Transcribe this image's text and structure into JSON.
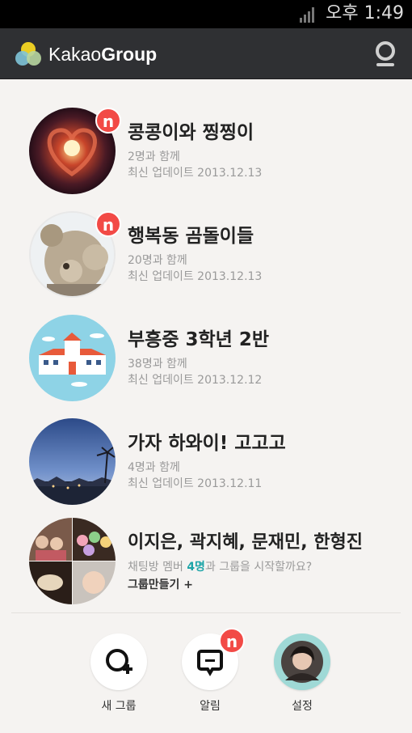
{
  "status_bar": {
    "time": "오후 1:49"
  },
  "app_bar": {
    "brand_light": "Kakao",
    "brand_bold": "Group"
  },
  "groups": [
    {
      "title": "콩콩이와 찡찡이",
      "members": "2명과 함께",
      "updated": "최신 업데이트 2013.12.13",
      "badge": "n"
    },
    {
      "title": "행복동 곰돌이들",
      "members": "20명과 함께",
      "updated": "최신 업데이트 2013.12.13",
      "badge": "n"
    },
    {
      "title": "부흥중 3학년 2반",
      "members": "38명과 함께",
      "updated": "최신 업데이트 2013.12.12"
    },
    {
      "title": "가자 하와이! 고고고",
      "members": "4명과 함께",
      "updated": "최신 업데이트 2013.12.11"
    }
  ],
  "suggestion": {
    "title": "이지은, 곽지혜, 문재민, 한형진",
    "text_before": "채팅방 멤버 ",
    "count": "4명",
    "text_after": "과 그룹을 시작할까요?",
    "create_label": "그룹만들기",
    "create_plus": "+"
  },
  "bottom": {
    "new_group": "새 그룹",
    "notifications": "알림",
    "notifications_badge": "n",
    "settings": "설정"
  },
  "colors": {
    "badge": "#f24a46",
    "accent": "#1ea5a8",
    "appbar": "#2f3033"
  }
}
